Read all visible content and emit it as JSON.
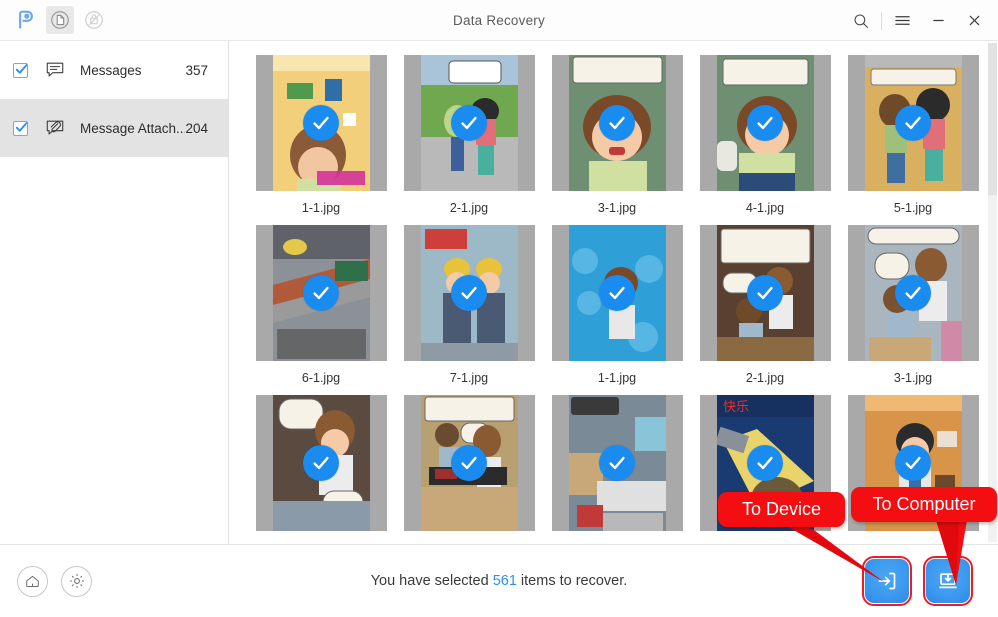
{
  "window": {
    "title": "Data Recovery",
    "controls": {
      "search": "search-icon",
      "menu": "menu-icon",
      "minimize": "minimize-icon",
      "close": "close-icon"
    },
    "toolbar_icons": [
      "logo-icon",
      "recover-from-device-icon",
      "recover-from-backup-icon"
    ]
  },
  "sidebar": {
    "items": [
      {
        "label": "Messages",
        "count": "357",
        "icon": "message-bubble-icon",
        "checked": true,
        "selected": false
      },
      {
        "label": "Message Attach...",
        "count": "204",
        "icon": "message-attachment-icon",
        "checked": true,
        "selected": true
      }
    ]
  },
  "grid": {
    "items": [
      {
        "filename": "1-1.jpg",
        "selected": true,
        "art": "tissues"
      },
      {
        "filename": "2-1.jpg",
        "selected": true,
        "art": "park"
      },
      {
        "filename": "3-1.jpg",
        "selected": true,
        "art": "crying"
      },
      {
        "filename": "4-1.jpg",
        "selected": true,
        "art": "bed"
      },
      {
        "filename": "5-1.jpg",
        "selected": true,
        "art": "couple"
      },
      {
        "filename": "6-1.jpg",
        "selected": true,
        "art": "bridge"
      },
      {
        "filename": "7-1.jpg",
        "selected": true,
        "art": "workers"
      },
      {
        "filename": "1-1.jpg",
        "selected": true,
        "art": "math"
      },
      {
        "filename": "2-1.jpg",
        "selected": true,
        "art": "classroom"
      },
      {
        "filename": "3-1.jpg",
        "selected": true,
        "art": "teacher"
      },
      {
        "filename": "",
        "selected": true,
        "art": "desk"
      },
      {
        "filename": "",
        "selected": true,
        "art": "students"
      },
      {
        "filename": "",
        "selected": true,
        "art": "bedroom"
      },
      {
        "filename": "",
        "selected": true,
        "art": "flashlight"
      },
      {
        "filename": "",
        "selected": true,
        "art": "office"
      }
    ]
  },
  "footer": {
    "home_icon": "home-icon",
    "settings_icon": "gear-icon",
    "status_prefix": "You have selected ",
    "status_count": "561",
    "status_suffix": " items to recover.",
    "to_device_button": "to-device-icon",
    "to_computer_button": "to-computer-icon"
  },
  "callouts": {
    "to_device": "To Device",
    "to_computer": "To Computer",
    "color": "#f40d11"
  },
  "colors": {
    "accent": "#2a90e8",
    "check_circle": "#1a8cf0",
    "callout_red": "#f40d11",
    "sidebar_selected": "#e3e3e3"
  }
}
